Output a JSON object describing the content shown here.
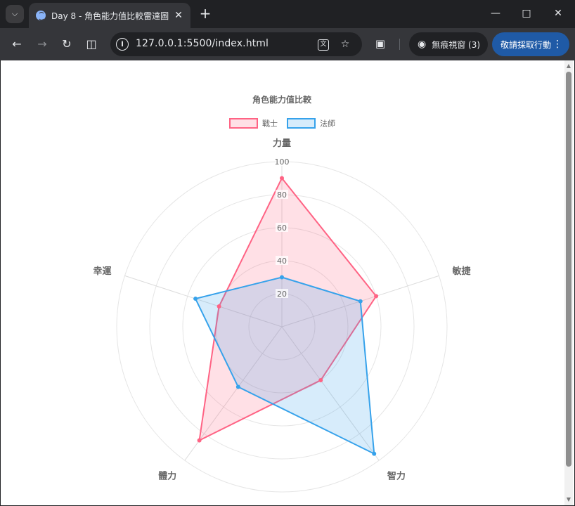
{
  "browser": {
    "tab_title": "Day 8 - 角色能力值比較雷達圖",
    "url": "127.0.0.1:5500/index.html",
    "incognito_label": "無痕視窗 (3)",
    "action_label": "敬請採取行動",
    "icons": {
      "tab_search": "chevron-down-icon",
      "favicon": "globe-icon",
      "close": "close-icon",
      "new_tab": "plus-icon",
      "minimize": "minimize-icon",
      "maximize": "maximize-icon",
      "window_close": "close-icon",
      "back": "arrow-left-icon",
      "forward": "arrow-right-icon",
      "reload": "reload-icon",
      "split": "split-view-icon",
      "info": "info-icon",
      "translate": "translate-icon",
      "bookmark": "star-icon",
      "lens": "lens-icon",
      "incognito": "incognito-icon",
      "menu": "more-vert-icon"
    },
    "colors": {
      "frame": "#202124",
      "toolbar": "#35363a",
      "action": "#1f5aa6"
    }
  },
  "chart_data": {
    "type": "radar",
    "title": "角色能力值比較",
    "axes": [
      "力量",
      "敏捷",
      "智力",
      "體力",
      "幸運"
    ],
    "r_ticks": [
      20,
      40,
      60,
      80,
      100
    ],
    "r_range": [
      0,
      100
    ],
    "grid": true,
    "legend_position": "top",
    "series": [
      {
        "name": "戰士",
        "values": [
          90,
          60,
          40,
          85,
          40
        ],
        "border": "#ff6384",
        "fill": "rgba(255,99,132,0.2)"
      },
      {
        "name": "法師",
        "values": [
          30,
          50,
          95,
          45,
          55
        ],
        "border": "#36a2eb",
        "fill": "rgba(54,162,235,0.2)"
      }
    ]
  }
}
